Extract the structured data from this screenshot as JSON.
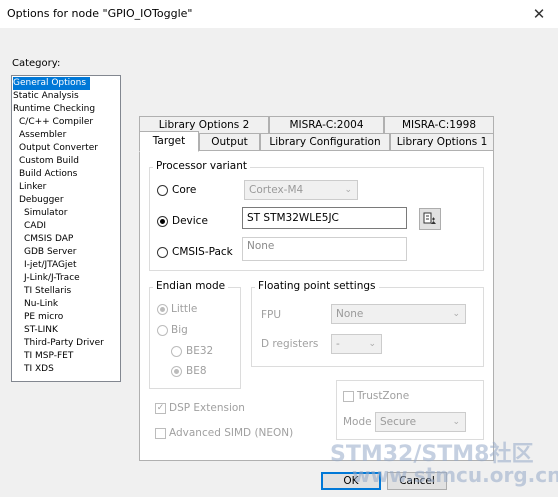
{
  "window": {
    "title": "Options for node \"GPIO_IOToggle\"",
    "close_glyph": "✕"
  },
  "category": {
    "label": "Category:",
    "items": [
      {
        "label": "General Options",
        "indent": 0,
        "selected": true
      },
      {
        "label": "Static Analysis",
        "indent": 0
      },
      {
        "label": "Runtime Checking",
        "indent": 0
      },
      {
        "label": "C/C++ Compiler",
        "indent": 1
      },
      {
        "label": "Assembler",
        "indent": 1
      },
      {
        "label": "Output Converter",
        "indent": 1
      },
      {
        "label": "Custom Build",
        "indent": 1
      },
      {
        "label": "Build Actions",
        "indent": 1
      },
      {
        "label": "Linker",
        "indent": 1
      },
      {
        "label": "Debugger",
        "indent": 1
      },
      {
        "label": "Simulator",
        "indent": 2
      },
      {
        "label": "CADI",
        "indent": 2
      },
      {
        "label": "CMSIS DAP",
        "indent": 2
      },
      {
        "label": "GDB Server",
        "indent": 2
      },
      {
        "label": "I-jet/JTAGjet",
        "indent": 2
      },
      {
        "label": "J-Link/J-Trace",
        "indent": 2
      },
      {
        "label": "TI Stellaris",
        "indent": 2
      },
      {
        "label": "Nu-Link",
        "indent": 2
      },
      {
        "label": "PE micro",
        "indent": 2
      },
      {
        "label": "ST-LINK",
        "indent": 2
      },
      {
        "label": "Third-Party Driver",
        "indent": 2
      },
      {
        "label": "TI MSP-FET",
        "indent": 2
      },
      {
        "label": "TI XDS",
        "indent": 2
      }
    ]
  },
  "tabs": {
    "row1": [
      "Library Options 2",
      "MISRA-C:2004",
      "MISRA-C:1998"
    ],
    "row2": [
      "Target",
      "Output",
      "Library Configuration",
      "Library Options 1"
    ],
    "active": "Target"
  },
  "processor": {
    "group_label": "Processor variant",
    "core_label": "Core",
    "core_value": "Cortex-M4",
    "device_label": "Device",
    "device_value": "ST STM32WLE5JC",
    "cmsis_label": "CMSIS-Pack",
    "cmsis_value": "None",
    "selected": "Device"
  },
  "endian": {
    "group_label": "Endian mode",
    "little": "Little",
    "big": "Big",
    "be32": "BE32",
    "be8": "BE8"
  },
  "fp": {
    "group_label": "Floating point settings",
    "fpu_label": "FPU",
    "fpu_value": "None",
    "dreg_label": "D registers",
    "dreg_value": "-"
  },
  "trustzone": {
    "label": "TrustZone",
    "mode_label": "Mode",
    "mode_value": "Secure"
  },
  "extensions": {
    "dsp": "DSP Extension",
    "simd": "Advanced SIMD (NEON)",
    "check_glyph": "✓"
  },
  "buttons": {
    "ok": "OK",
    "cancel": "Cancel"
  },
  "watermark": {
    "line1": "STM32/STM8社区",
    "line2": "www.stmcu.org.cn"
  }
}
